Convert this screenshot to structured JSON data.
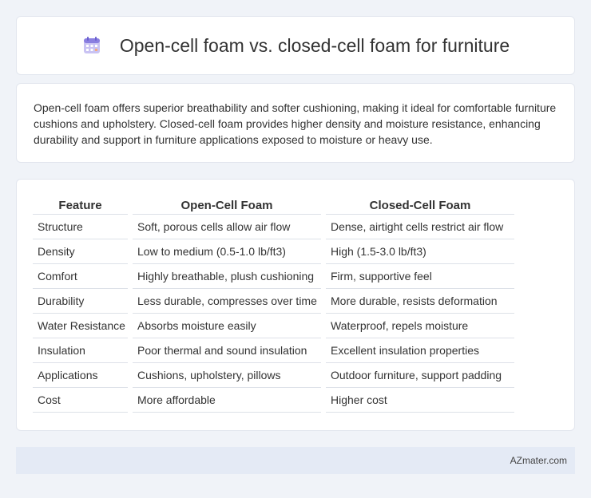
{
  "header": {
    "title": "Open-cell foam vs. closed-cell foam for furniture",
    "icon": "calendar-icon"
  },
  "summary": {
    "text": "Open-cell foam offers superior breathability and softer cushioning, making it ideal for comfortable furniture cushions and upholstery. Closed-cell foam provides higher density and moisture resistance, enhancing durability and support in furniture applications exposed to moisture or heavy use."
  },
  "table": {
    "headers": [
      "Feature",
      "Open-Cell Foam",
      "Closed-Cell Foam"
    ],
    "rows": [
      [
        "Structure",
        "Soft, porous cells allow air flow",
        "Dense, airtight cells restrict air flow"
      ],
      [
        "Density",
        "Low to medium (0.5-1.0 lb/ft3)",
        "High (1.5-3.0 lb/ft3)"
      ],
      [
        "Comfort",
        "Highly breathable, plush cushioning",
        "Firm, supportive feel"
      ],
      [
        "Durability",
        "Less durable, compresses over time",
        "More durable, resists deformation"
      ],
      [
        "Water Resistance",
        "Absorbs moisture easily",
        "Waterproof, repels moisture"
      ],
      [
        "Insulation",
        "Poor thermal and sound insulation",
        "Excellent insulation properties"
      ],
      [
        "Applications",
        "Cushions, upholstery, pillows",
        "Outdoor furniture, support padding"
      ],
      [
        "Cost",
        "More affordable",
        "Higher cost"
      ]
    ]
  },
  "footer": {
    "brand": "AZmater.com"
  },
  "colors": {
    "background": "#f0f3f8",
    "card": "#ffffff",
    "footer": "#e4eaf5",
    "icon_accent": "#8a7fe0"
  }
}
